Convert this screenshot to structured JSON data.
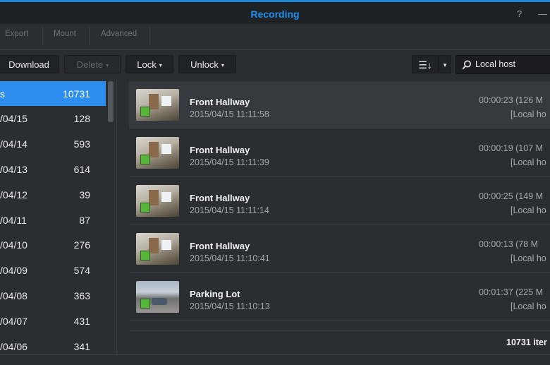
{
  "window": {
    "title": "Recording",
    "help_glyph": "?",
    "minimize_glyph": "—"
  },
  "menu": {
    "export": "Export",
    "mount": "Mount",
    "advanced": "Advanced"
  },
  "toolbar": {
    "download": "Download",
    "delete": "Delete",
    "lock": "Lock",
    "unlock": "Unlock",
    "sort_glyph": "☰↓",
    "dropdown_caret": "▾",
    "search_value": "Local host",
    "search_icon": "⚲"
  },
  "sidebar": {
    "items": [
      {
        "label": "s",
        "count": "10731"
      },
      {
        "label": "/04/15",
        "count": "128"
      },
      {
        "label": "/04/14",
        "count": "593"
      },
      {
        "label": "/04/13",
        "count": "614"
      },
      {
        "label": "/04/12",
        "count": "39"
      },
      {
        "label": "/04/11",
        "count": "87"
      },
      {
        "label": "/04/10",
        "count": "276"
      },
      {
        "label": "/04/09",
        "count": "574"
      },
      {
        "label": "/04/08",
        "count": "363"
      },
      {
        "label": "/04/07",
        "count": "431"
      },
      {
        "label": "/04/06",
        "count": "341"
      }
    ]
  },
  "recordings": [
    {
      "name": "Front Hallway",
      "datetime": "2015/04/15 11:11:58",
      "duration": "00:00:23 (126 M",
      "host": "[Local ho",
      "thumb": "hallway"
    },
    {
      "name": "Front Hallway",
      "datetime": "2015/04/15 11:11:39",
      "duration": "00:00:19 (107 M",
      "host": "[Local ho",
      "thumb": "hallway"
    },
    {
      "name": "Front Hallway",
      "datetime": "2015/04/15 11:11:14",
      "duration": "00:00:25 (149 M",
      "host": "[Local ho",
      "thumb": "hallway"
    },
    {
      "name": "Front Hallway",
      "datetime": "2015/04/15 11:10:41",
      "duration": "00:00:13 (78 M",
      "host": "[Local ho",
      "thumb": "hallway"
    },
    {
      "name": "Parking Lot",
      "datetime": "2015/04/15 11:10:13",
      "duration": "00:01:37 (225 M",
      "host": "[Local ho",
      "thumb": "parking"
    }
  ],
  "footer": {
    "item_count": "10731 iter"
  },
  "colors": {
    "accent": "#2d8ef0",
    "title": "#1e8ff0",
    "status_green": "#58b53b"
  }
}
